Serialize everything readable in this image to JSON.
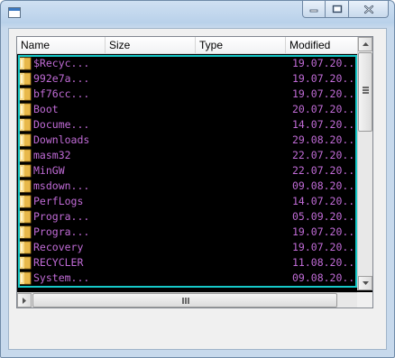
{
  "window": {
    "title": "",
    "caption_buttons": [
      "minimize-icon",
      "maximize-icon",
      "close-icon"
    ]
  },
  "listview": {
    "columns": [
      "Name",
      "Size",
      "Type",
      "Modified"
    ],
    "rows": [
      {
        "name": "$Recyc...",
        "size": "",
        "type": "",
        "modified": "19.07.20.."
      },
      {
        "name": "992e7a...",
        "size": "",
        "type": "",
        "modified": "19.07.20.."
      },
      {
        "name": "bf76cc...",
        "size": "",
        "type": "",
        "modified": "19.07.20.."
      },
      {
        "name": "Boot",
        "size": "",
        "type": "",
        "modified": "20.07.20.."
      },
      {
        "name": "Docume...",
        "size": "",
        "type": "",
        "modified": "14.07.20.."
      },
      {
        "name": "Downloads",
        "size": "",
        "type": "",
        "modified": "29.08.20.."
      },
      {
        "name": "masm32",
        "size": "",
        "type": "",
        "modified": "22.07.20.."
      },
      {
        "name": "MinGW",
        "size": "",
        "type": "",
        "modified": "22.07.20.."
      },
      {
        "name": "msdown...",
        "size": "",
        "type": "",
        "modified": "09.08.20.."
      },
      {
        "name": "PerfLogs",
        "size": "",
        "type": "",
        "modified": "14.07.20.."
      },
      {
        "name": "Progra...",
        "size": "",
        "type": "",
        "modified": "05.09.20.."
      },
      {
        "name": "Progra...",
        "size": "",
        "type": "",
        "modified": "19.07.20.."
      },
      {
        "name": "Recovery",
        "size": "",
        "type": "",
        "modified": "19.07.20.."
      },
      {
        "name": "RECYCLER",
        "size": "",
        "type": "",
        "modified": "11.08.20.."
      },
      {
        "name": "System...",
        "size": "",
        "type": "",
        "modified": "09.08.20.."
      }
    ],
    "row_icon": "folder-icon",
    "colors": {
      "background": "#000000",
      "text": "#c06bd6",
      "focus_border": "#16c8c8"
    }
  }
}
